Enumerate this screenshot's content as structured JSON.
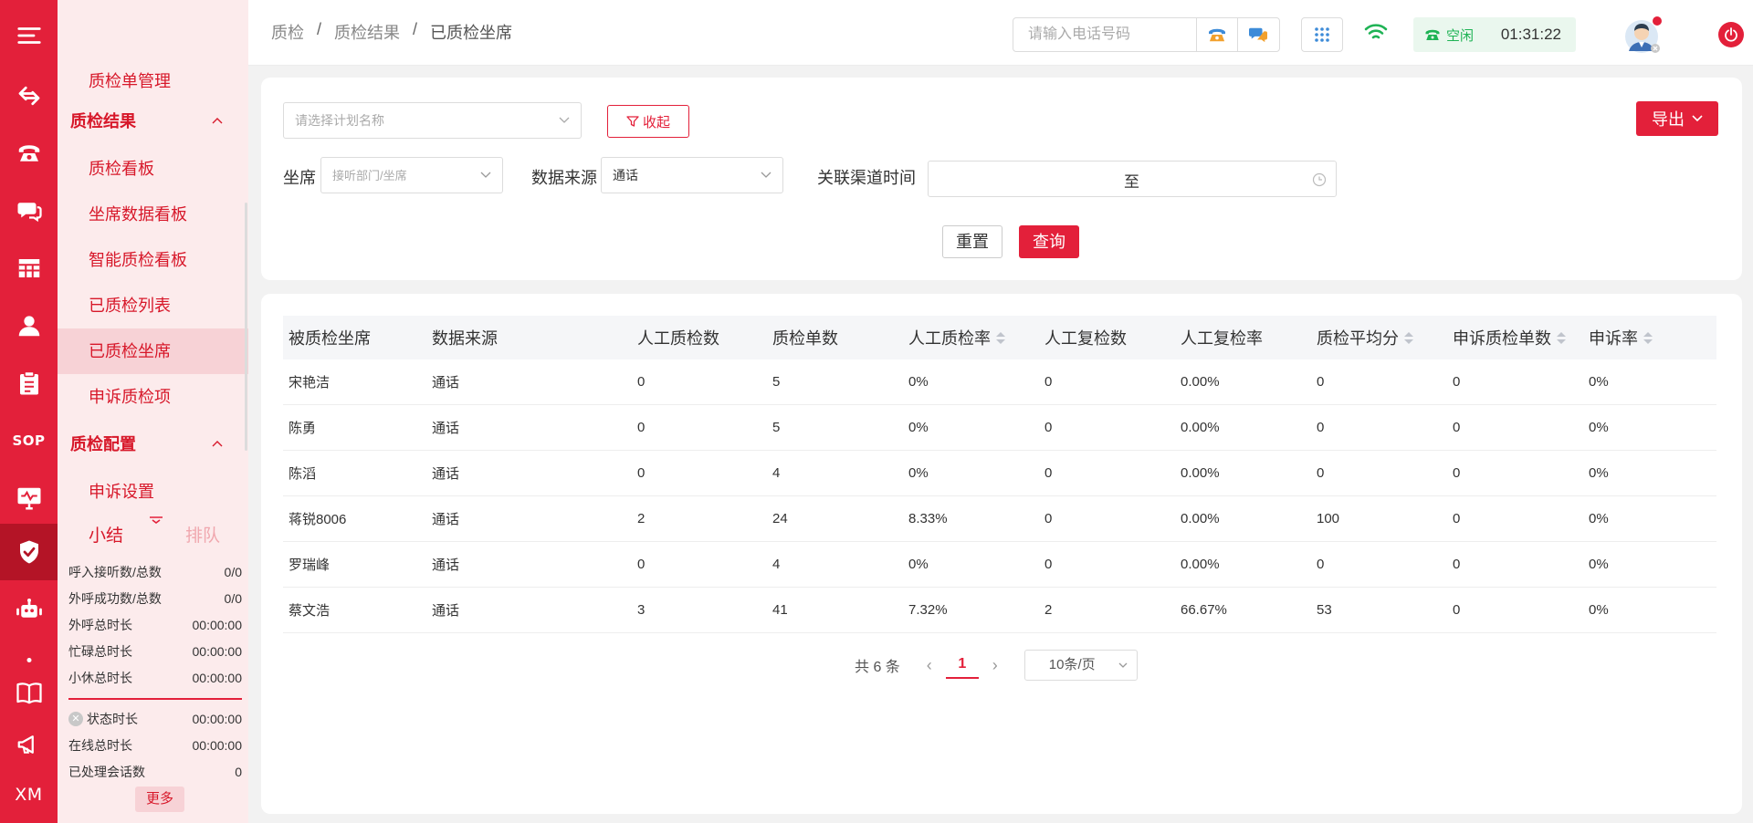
{
  "rail": {
    "items": [
      {
        "icon": "menu-icon"
      },
      {
        "icon": "swap-arrows-icon"
      },
      {
        "icon": "telephone-icon"
      },
      {
        "icon": "chat-icon"
      },
      {
        "icon": "table-grid-icon"
      },
      {
        "icon": "agent-person-icon"
      },
      {
        "icon": "clipboard-icon"
      },
      {
        "icon": "sop-icon",
        "label": "SOP"
      },
      {
        "icon": "monitor-icon"
      },
      {
        "icon": "shield-check-icon"
      },
      {
        "icon": "robot-icon"
      },
      {
        "icon": "dot-icon"
      },
      {
        "icon": "book-icon"
      },
      {
        "icon": "megaphone-icon"
      },
      {
        "icon": "xm-icon",
        "label": "XM"
      }
    ],
    "accent": "#e3203a"
  },
  "sidebar": {
    "items": [
      {
        "label": "质检单管理"
      },
      {
        "label": "质检结果",
        "group": true
      },
      {
        "label": "质检看板"
      },
      {
        "label": "坐席数据看板"
      },
      {
        "label": "智能质检看板"
      },
      {
        "label": "已质检列表"
      },
      {
        "label": "已质检坐席",
        "active": true
      },
      {
        "label": "申诉质检项"
      },
      {
        "label": "质检配置",
        "group": true
      },
      {
        "label": "申诉设置"
      }
    ],
    "tabs": {
      "summary": "小结",
      "queue": "排队"
    },
    "stats": [
      {
        "label": "呼入接听数/总数",
        "value": "0/0"
      },
      {
        "label": "外呼成功数/总数",
        "value": "0/0"
      },
      {
        "label": "外呼总时长",
        "value": "00:00:00"
      },
      {
        "label": "忙碌总时长",
        "value": "00:00:00"
      },
      {
        "label": "小休总时长",
        "value": "00:00:00"
      }
    ],
    "stats2": [
      {
        "label": "状态时长",
        "value": "00:00:00",
        "icon": "close-circle-icon"
      },
      {
        "label": "在线总时长",
        "value": "00:00:00"
      },
      {
        "label": "已处理会话数",
        "value": "0"
      }
    ],
    "more": "更多"
  },
  "header": {
    "breadcrumb": [
      "质检",
      "质检结果",
      "已质检坐席"
    ],
    "phone_placeholder": "请输入电话号码",
    "status": "空闲",
    "timer": "01:31:22",
    "status_color": "#1fb355"
  },
  "filters": {
    "plan_placeholder": "请选择计划名称",
    "collapse": "收起",
    "export": "导出",
    "agent_label": "坐席",
    "agent_placeholder": "接听部门/坐席",
    "source_label": "数据来源",
    "source_value": "通话",
    "time_label": "关联渠道时间",
    "time_sep": "至",
    "reset": "重置",
    "query": "查询"
  },
  "table": {
    "columns": [
      {
        "label": "被质检坐席"
      },
      {
        "label": "数据来源"
      },
      {
        "label": "人工质检数"
      },
      {
        "label": "质检单数"
      },
      {
        "label": "人工质检率",
        "sortable": true
      },
      {
        "label": "人工复检数"
      },
      {
        "label": "人工复检率"
      },
      {
        "label": "质检平均分",
        "sortable": true
      },
      {
        "label": "申诉质检单数",
        "sortable": true
      },
      {
        "label": "申诉率",
        "sortable": true
      }
    ],
    "rows": [
      [
        "宋艳洁",
        "通话",
        "0",
        "5",
        "0%",
        "0",
        "0.00%",
        "0",
        "0",
        "0%"
      ],
      [
        "陈勇",
        "通话",
        "0",
        "5",
        "0%",
        "0",
        "0.00%",
        "0",
        "0",
        "0%"
      ],
      [
        "陈滔",
        "通话",
        "0",
        "4",
        "0%",
        "0",
        "0.00%",
        "0",
        "0",
        "0%"
      ],
      [
        "蒋锐8006",
        "通话",
        "2",
        "24",
        "8.33%",
        "0",
        "0.00%",
        "100",
        "0",
        "0%"
      ],
      [
        "罗瑞峰",
        "通话",
        "0",
        "4",
        "0%",
        "0",
        "0.00%",
        "0",
        "0",
        "0%"
      ],
      [
        "蔡文浩",
        "通话",
        "3",
        "41",
        "7.32%",
        "2",
        "66.67%",
        "53",
        "0",
        "0%"
      ]
    ]
  },
  "pagination": {
    "total": "共 6 条",
    "current": "1",
    "page_size": "10条/页"
  }
}
